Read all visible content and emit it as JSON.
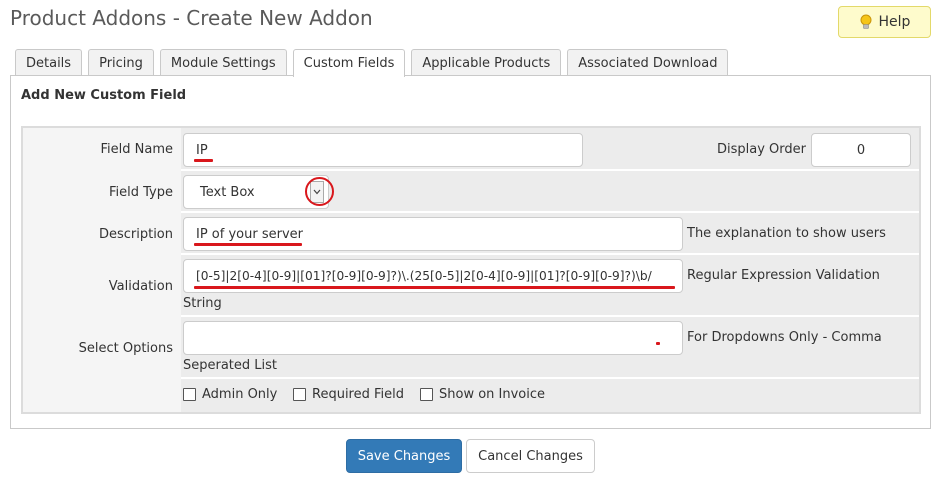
{
  "page": {
    "title": "Product Addons - Create New Addon"
  },
  "help": {
    "label": "Help",
    "icon": "lightbulb-icon"
  },
  "tabs": [
    {
      "label": "Details",
      "active": false
    },
    {
      "label": "Pricing",
      "active": false
    },
    {
      "label": "Module Settings",
      "active": false
    },
    {
      "label": "Custom Fields",
      "active": true
    },
    {
      "label": "Applicable Products",
      "active": false
    },
    {
      "label": "Associated Download",
      "active": false
    }
  ],
  "section": {
    "heading": "Add New Custom Field"
  },
  "form": {
    "field_name": {
      "label": "Field Name",
      "value": "IP"
    },
    "display_order": {
      "label": "Display Order",
      "value": "0"
    },
    "field_type": {
      "label": "Field Type",
      "value": "Text Box"
    },
    "description": {
      "label": "Description",
      "value": "IP of your server",
      "hint": "The explanation to show users"
    },
    "validation": {
      "label": "Validation",
      "value": "[0-5]|2[0-4][0-9]|[01]?[0-9][0-9]?)\\.(25[0-5]|2[0-4][0-9]|[01]?[0-9][0-9]?)\\b/",
      "hint_line1": "Regular Expression Validation",
      "hint_line2": "String"
    },
    "select_options": {
      "label": "Select Options",
      "value": "",
      "hint_line1": "For Dropdowns Only - Comma",
      "hint_line2": "Seperated List"
    },
    "checkboxes": [
      {
        "label": "Admin Only",
        "checked": false
      },
      {
        "label": "Required Field",
        "checked": false
      },
      {
        "label": "Show on Invoice",
        "checked": false
      }
    ]
  },
  "actions": {
    "save_label": "Save Changes",
    "cancel_label": "Cancel Changes"
  },
  "colors": {
    "primary": "#337ab7",
    "annotation_red": "#d9171c",
    "help_bg": "#fefbcc"
  }
}
